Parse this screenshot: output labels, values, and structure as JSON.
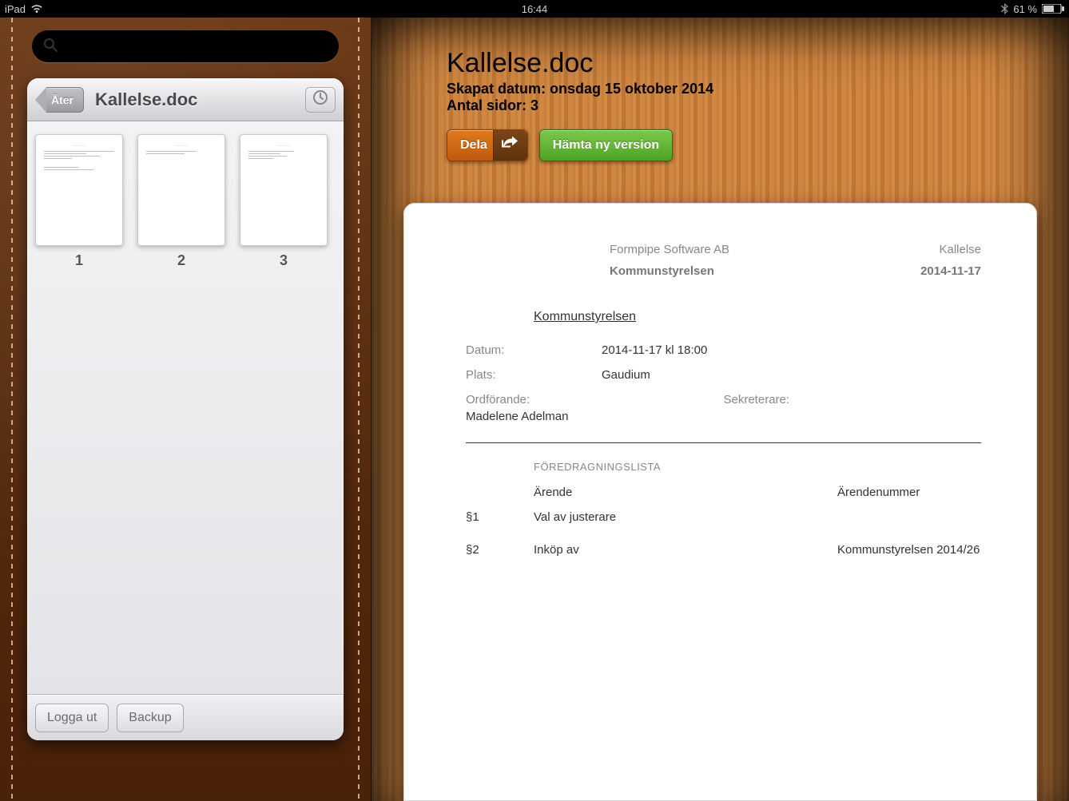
{
  "statusbar": {
    "device": "iPad",
    "time": "16:44",
    "battery": "61 %"
  },
  "sidebar": {
    "back_label": "Åter",
    "title": "Kallelse.doc",
    "thumbs": [
      "1",
      "2",
      "3"
    ],
    "logout_label": "Logga ut",
    "backup_label": "Backup",
    "search_placeholder": ""
  },
  "meta": {
    "filename": "Kallelse.doc",
    "created_line": "Skapat datum: onsdag 15 oktober 2014",
    "pages_line": "Antal sidor: 3"
  },
  "actions": {
    "share_label": "Dela",
    "update_label": "Hämta ny version"
  },
  "document": {
    "org": "Formpipe Software AB",
    "doctype": "Kallelse",
    "board": "Kommunstyrelsen",
    "date_header": "2014-11-17",
    "heading": "Kommunstyrelsen",
    "datum_label": "Datum:",
    "datum_value": "2014-11-17 kl 18:00",
    "plats_label": "Plats:",
    "plats_value": "Gaudium",
    "ordf_label": "Ordförande:",
    "ordf_value": "Madelene Adelman",
    "sekr_label": "Sekreterare:",
    "agenda_heading": "FÖREDRAGNINGSLISTA",
    "col_arende": "Ärende",
    "col_nummer": "Ärendenummer",
    "rows": [
      {
        "sec": "§1",
        "title": "Val av justerare",
        "num": ""
      },
      {
        "sec": "§2",
        "title": "Inköp av",
        "num": "Kommunstyrelsen 2014/26"
      }
    ]
  }
}
